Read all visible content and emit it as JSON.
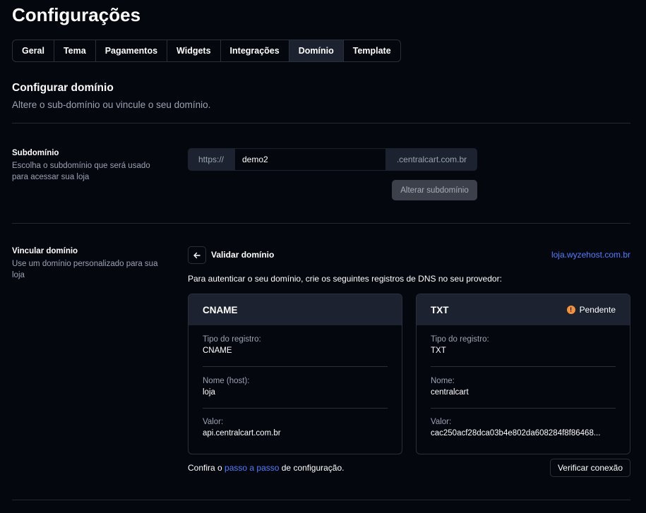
{
  "page": {
    "title": "Configurações"
  },
  "tabs": [
    {
      "label": "Geral"
    },
    {
      "label": "Tema"
    },
    {
      "label": "Pagamentos"
    },
    {
      "label": "Widgets"
    },
    {
      "label": "Integrações"
    },
    {
      "label": "Domínio",
      "active": true
    },
    {
      "label": "Template"
    }
  ],
  "section": {
    "title": "Configurar domínio",
    "subtitle": "Altere o sub-domínio ou vincule o seu domínio."
  },
  "subdomain": {
    "label": "Subdomínio",
    "description": "Escolha o subdomínio que será usado para acessar sua loja",
    "prefix": "https://",
    "value": "demo2",
    "suffix": ".centralcart.com.br",
    "button": "Alterar subdomínio"
  },
  "link_domain": {
    "label": "Vincular domínio",
    "description": "Use um domínio personalizado para sua loja",
    "validate_title": "Validar domínio",
    "domain": "loja.wyzehost.com.br",
    "instructions": "Para autenticar o seu domínio, crie os seguintes registros de DNS no seu provedor:",
    "help_prefix": "Confira o ",
    "help_link": "passo a passo",
    "help_suffix": " de configuração.",
    "verify_button": "Verificar conexão"
  },
  "records": {
    "cname": {
      "title": "CNAME",
      "type_label": "Tipo do registro:",
      "type_value": "CNAME",
      "name_label": "Nome (host):",
      "name_value": "loja",
      "value_label": "Valor:",
      "value_value": "api.centralcart.com.br"
    },
    "txt": {
      "title": "TXT",
      "status": "Pendente",
      "status_color": "#f5913a",
      "type_label": "Tipo do registro:",
      "type_value": "TXT",
      "name_label": "Nome:",
      "name_value": "centralcart",
      "value_label": "Valor:",
      "value_value": "cac250acf28dca03b4e802da608284f8f86468..."
    }
  },
  "colors": {
    "background": "#05070f",
    "panel": "#1c2230",
    "border": "#2a2f3a",
    "link": "#4e7fff",
    "muted": "#9aa3b2"
  }
}
